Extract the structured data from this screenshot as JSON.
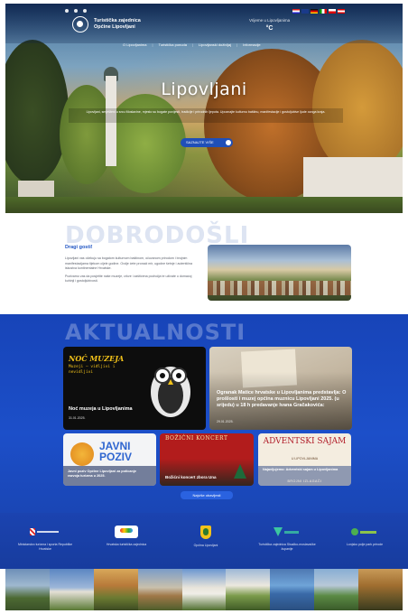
{
  "header": {
    "logo_text": "Turistička zajednica Općine Lipovljani",
    "weather_label": "Vrijeme u Lipovljanima",
    "weather_value": "°C",
    "nav": [
      "O Lipovljanima",
      "Turistička ponuda",
      "Lipovljanski doživljaj",
      "Informacije"
    ]
  },
  "hero": {
    "title": "Lipovljani",
    "description": "Lipovljani, smješteni u srcu Moslavine, mjesto su bogate povijesti, tradicije i prirodnih ljepota. Upoznajte kulturnu baštinu, manifestacije i gostoljubive ljude ovoga kraja.",
    "button_label": "SAZNAJTE VIŠE"
  },
  "welcome": {
    "title": "DOBRODOŠLI",
    "subtitle": "Dragi gosti!",
    "paragraphs": [
      "Lipovljani vas očekuju sa bogatom kulturnom baštinom, očuvanom prirodom i brojnim manifestacijama tijekom cijele godine. Ovdje ćete pronaći mir, ugodne šetnje i autentična iskustva kontinentalne Hrvatske.",
      "Pozivamo vas da posjetite naše muzeje, crkve i zaštićena područja te uživate u domaćoj kuhinji i gostoljubivosti."
    ]
  },
  "news": {
    "title": "AKTUALNOSTI",
    "cards": [
      {
        "title": "Noć muzeja u Lipovljanima",
        "date": "31.01.2025.",
        "poster_title": "NOĆ MUZEJA",
        "poster_text": "Muzeji – viđljivi i nevidljivi"
      },
      {
        "title": "Ogranak Matice hrvatske u Lipovljanima predstavlja: O prošlosti i muzej općina muznicu Lipovljani 2025. (u srijedu) u 18 h predavanje Ivana Gračakovića:",
        "date": "29.01.2025."
      },
      {
        "title": "Javni poziv Općine Lipovljani za poticanje razvoja turizma u 2025.",
        "poster_text": "JAVNI POZIV"
      },
      {
        "title": "Božićni koncert zbora Una",
        "poster_text": "BOŽIĆNI KONCERT"
      },
      {
        "title": "Najavljujemo: Adventski sajam u Lipovljanima",
        "poster_text": "ADVENTSKI SAJAM",
        "poster_sub": "U LIPOVLJANIMA",
        "poster_foot": "BROJNI IZLAGAČI"
      }
    ],
    "more_label": "Najviše obavijesti"
  },
  "footer_logos": [
    {
      "label": "Ministarstvo turizma i sporta Republike Hrvatske"
    },
    {
      "label": "Hrvatska turistička zajednica"
    },
    {
      "label": "Općina Lipovljani"
    },
    {
      "label": "Turistička zajednica Sisačko-moslavačke županije"
    },
    {
      "label": "Lonjsko polje park prirode"
    }
  ],
  "colors": {
    "primary": "#1c4fc9",
    "accent": "#2458c4",
    "poster_yellow": "#f2c21a"
  }
}
